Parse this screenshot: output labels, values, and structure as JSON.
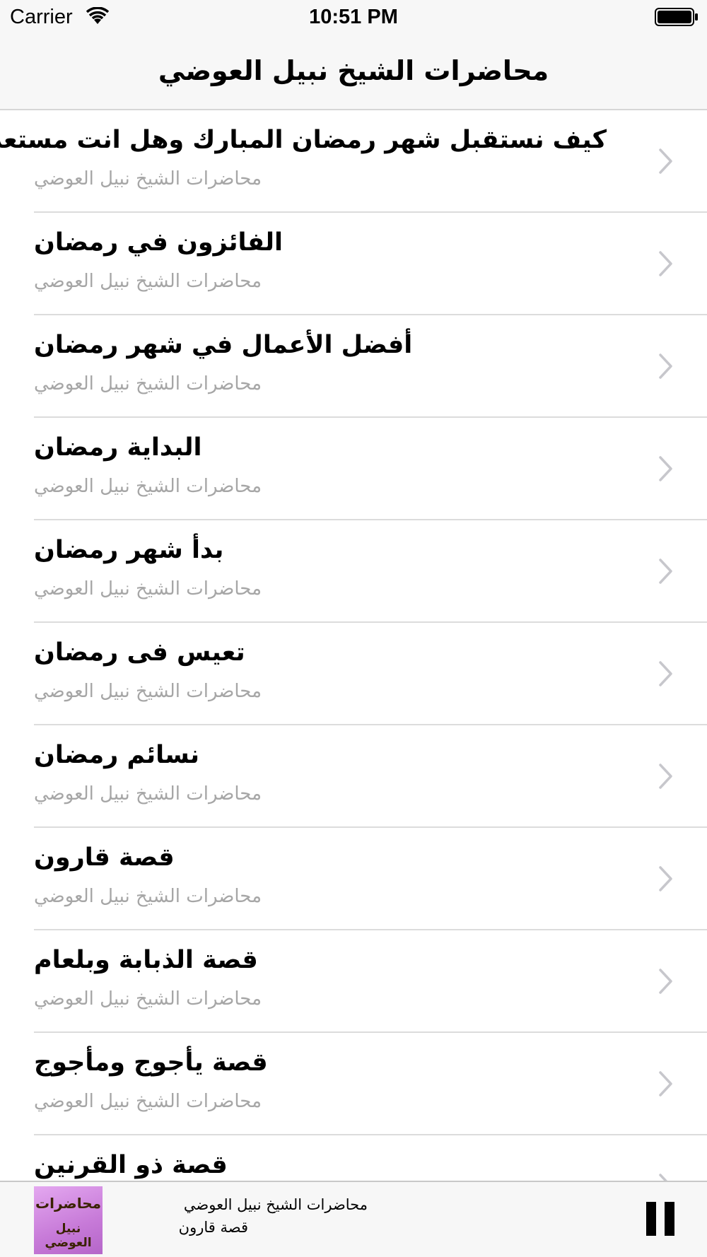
{
  "status_bar": {
    "carrier": "Carrier",
    "time": "10:51 PM",
    "wifi_icon": "wifi-icon",
    "battery_icon": "battery-icon"
  },
  "nav": {
    "title": "محاضرات الشيخ نبيل العوضي"
  },
  "list": {
    "items": [
      {
        "title": "كيف نستقبل شهر رمضان المبارك وهل انت مستعد له",
        "subtitle": "محاضرات الشيخ نبيل العوضي"
      },
      {
        "title": "الفائزون في رمضان",
        "subtitle": "محاضرات الشيخ نبيل العوضي"
      },
      {
        "title": "أفضل الأعمال في شهر رمضان",
        "subtitle": "محاضرات الشيخ نبيل العوضي"
      },
      {
        "title": "البداية رمضان",
        "subtitle": "محاضرات الشيخ نبيل العوضي"
      },
      {
        "title": "بدأ شهر رمضان",
        "subtitle": "محاضرات الشيخ نبيل العوضي"
      },
      {
        "title": "تعيس فى رمضان",
        "subtitle": "محاضرات الشيخ نبيل العوضي"
      },
      {
        "title": "نسائم رمضان",
        "subtitle": "محاضرات الشيخ نبيل العوضي"
      },
      {
        "title": "قصة قارون",
        "subtitle": "محاضرات الشيخ نبيل العوضي"
      },
      {
        "title": "قصة الذبابة وبلعام",
        "subtitle": "محاضرات الشيخ نبيل العوضي"
      },
      {
        "title": "قصة يأجوج ومأجوج",
        "subtitle": "محاضرات الشيخ نبيل العوضي"
      },
      {
        "title": "قصة ذو القرنين",
        "subtitle": ""
      }
    ],
    "chevron_icon": "chevron-right-icon"
  },
  "player": {
    "artwork_line1": "محاضرات",
    "artwork_line2": "نبيل العوضي",
    "line1": "محاضرات الشيخ نبيل العوضي",
    "line2": "قصة قارون",
    "pause_icon": "pause-icon"
  },
  "colors": {
    "bar_background": "#f7f7f7",
    "subtitle_gray": "#a6a6a6",
    "separator": "#dcdcdc"
  }
}
